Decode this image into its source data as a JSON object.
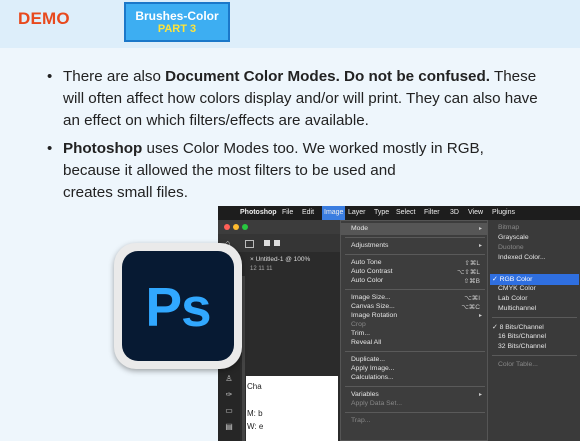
{
  "header": {
    "demo_label": "DEMO",
    "badge_line1": "Brushes-Color",
    "badge_line2": "PART 3"
  },
  "bullets": [
    {
      "b1": "There are also ",
      "b1_bold": "Document Color Modes. Do not be confused.",
      "b1_rest": " These will often affect how colors display and/or will print. They can also have an effect on which filters/effects are available."
    },
    {
      "b2_bold": "Photoshop",
      "b2_line1": " uses Color Modes too. We worked mostly in RGB,",
      "b2_line2": "because it allowed the most filters to be used and",
      "b2_line3": "creates small files."
    }
  ],
  "icon": {
    "label": "Ps",
    "bg": "#071a33",
    "fg": "#31a8ff"
  },
  "screenshot": {
    "menubar": {
      "apple": "",
      "app": "Photoshop",
      "file": "File",
      "edit": "Edit",
      "image": "Image",
      "layer": "Layer",
      "type": "Type",
      "select": "Select",
      "filter": "Filter",
      "3d": "3D",
      "view": "View",
      "plugins": "Plugins"
    },
    "doc_tab": "Untitled-1 @ 100%",
    "ruler": "12  11  11",
    "canvas_lines": [
      "Cha",
      "M: b",
      "W: e"
    ],
    "menu": {
      "mode": "Mode",
      "adjustments": "Adjustments",
      "auto_tone": "Auto Tone",
      "auto_tone_sc": "⇧⌘L",
      "auto_contrast": "Auto Contrast",
      "auto_contrast_sc": "⌥⇧⌘L",
      "auto_color": "Auto Color",
      "auto_color_sc": "⇧⌘B",
      "image_size": "Image Size...",
      "image_size_sc": "⌥⌘I",
      "canvas_size": "Canvas Size...",
      "canvas_size_sc": "⌥⌘C",
      "image_rotation": "Image Rotation",
      "crop": "Crop",
      "trim": "Trim...",
      "reveal_all": "Reveal All",
      "duplicate": "Duplicate...",
      "apply_image": "Apply Image...",
      "calculations": "Calculations...",
      "variables": "Variables",
      "apply_data_set": "Apply Data Set...",
      "trap": "Trap..."
    },
    "submenu": {
      "bitmap": "Bitmap",
      "grayscale": "Grayscale",
      "duotone": "Duotone",
      "indexed": "Indexed Color...",
      "rgb": "✓ RGB Color",
      "cmyk": "CMYK Color",
      "lab": "Lab Color",
      "multichannel": "Multichannel",
      "bits8": "✓ 8 Bits/Channel",
      "bits16": "16 Bits/Channel",
      "bits32": "32 Bits/Channel",
      "color_table": "Color Table..."
    }
  },
  "colors": {
    "accent": "#e8491d",
    "highlight": "#2f6fe0",
    "badge": "#3daef2"
  }
}
